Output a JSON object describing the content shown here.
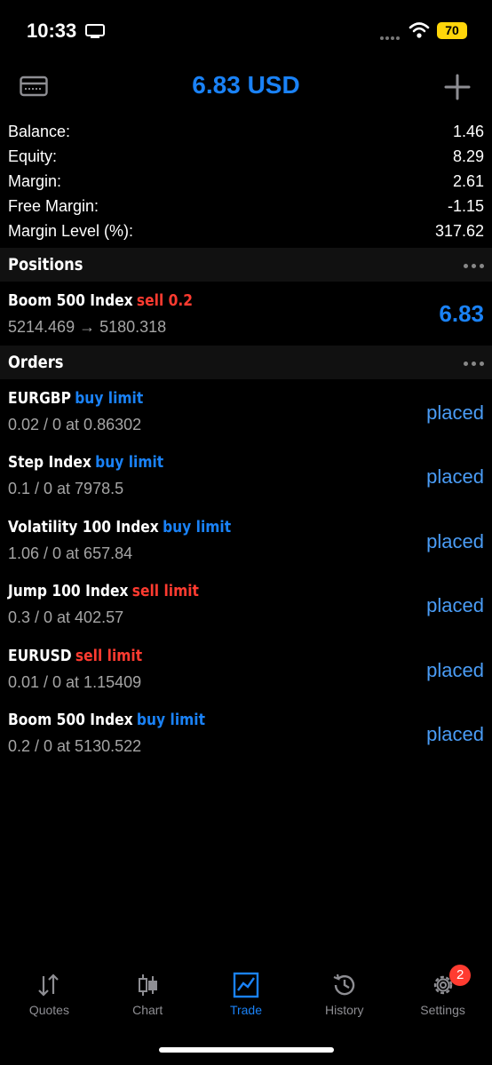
{
  "status_bar": {
    "time": "10:33",
    "battery": "70"
  },
  "header": {
    "title": "6.83 USD"
  },
  "summary": [
    {
      "label": "Balance:",
      "value": "1.46"
    },
    {
      "label": "Equity:",
      "value": "8.29"
    },
    {
      "label": "Margin:",
      "value": "2.61"
    },
    {
      "label": "Free Margin:",
      "value": "-1.15"
    },
    {
      "label": "Margin Level (%):",
      "value": "317.62"
    }
  ],
  "positions": {
    "title": "Positions",
    "items": [
      {
        "symbol": "Boom 500 Index",
        "side": "sell 0.2",
        "prices": "5214.469 → 5180.318",
        "profit": "6.83"
      }
    ]
  },
  "orders": {
    "title": "Orders",
    "items": [
      {
        "symbol": "EURGBP",
        "side": "buy limit",
        "detail": "0.02 / 0 at 0.86302",
        "status": "placed"
      },
      {
        "symbol": "Step Index",
        "side": "buy limit",
        "detail": "0.1 / 0 at 7978.5",
        "status": "placed"
      },
      {
        "symbol": "Volatility 100 Index",
        "side": "buy limit",
        "detail": "1.06 / 0 at 657.84",
        "status": "placed"
      },
      {
        "symbol": "Jump 100 Index",
        "side": "sell limit",
        "detail": "0.3 / 0 at 402.57",
        "status": "placed"
      },
      {
        "symbol": "EURUSD",
        "side": "sell limit",
        "detail": "0.01 / 0 at 1.15409",
        "status": "placed"
      },
      {
        "symbol": "Boom 500 Index",
        "side": "buy limit",
        "detail": "0.2 / 0 at 5130.522",
        "status": "placed"
      }
    ]
  },
  "tabs": [
    {
      "label": "Quotes",
      "icon": "quotes-icon"
    },
    {
      "label": "Chart",
      "icon": "candlestick-icon"
    },
    {
      "label": "Trade",
      "icon": "trade-chart-icon",
      "active": true
    },
    {
      "label": "History",
      "icon": "history-icon"
    },
    {
      "label": "Settings",
      "icon": "gear-icon",
      "badge": "2"
    }
  ],
  "colors": {
    "accent": "#1a82f7",
    "sell": "#ff3b30",
    "muted": "#a5a5a5",
    "battery": "#ffd60a"
  }
}
